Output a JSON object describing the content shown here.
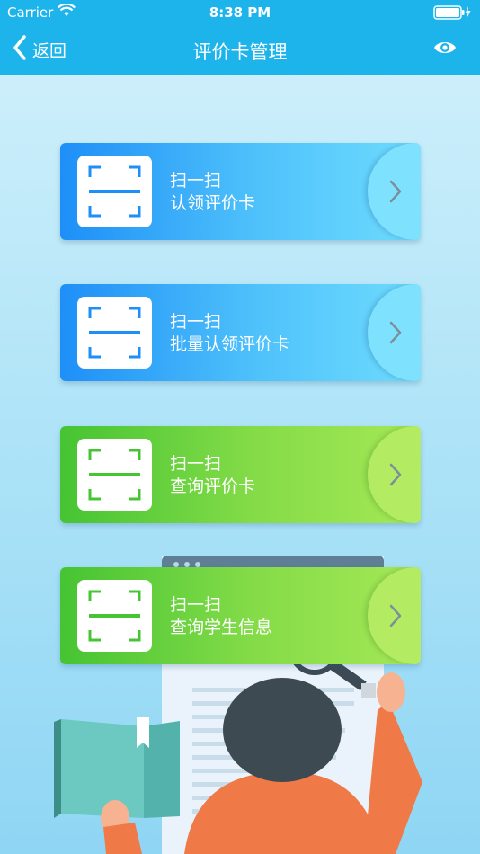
{
  "status_bar": {
    "carrier": "Carrier",
    "time": "8:38 PM"
  },
  "nav": {
    "back_label": "返回",
    "title": "评价卡管理"
  },
  "cards": [
    {
      "line1": "扫一扫",
      "line2": "认领评价卡",
      "theme": "blue"
    },
    {
      "line1": "扫一扫",
      "line2": "批量认领评价卡",
      "theme": "blue"
    },
    {
      "line1": "扫一扫",
      "line2": "查询评价卡",
      "theme": "green"
    },
    {
      "line1": "扫一扫",
      "line2": "查询学生信息",
      "theme": "green"
    }
  ],
  "colors": {
    "bar": "#1db4ec",
    "blue_icon": "#1e8ff7",
    "green_icon": "#46c433"
  }
}
